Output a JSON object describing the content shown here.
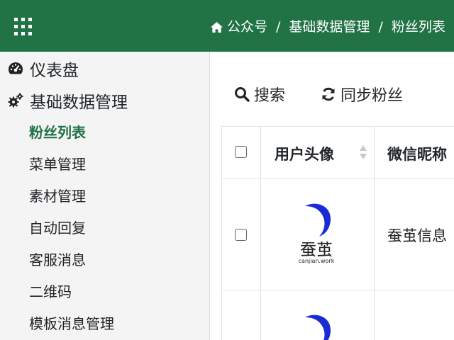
{
  "header": {
    "breadcrumb": [
      "公众号",
      "基础数据管理",
      "粉丝列表"
    ],
    "separator": "/",
    "bg_color": "#217346"
  },
  "sidebar": {
    "top_items": [
      {
        "label": "仪表盘",
        "icon": "dashboard-gauge-icon"
      },
      {
        "label": "基础数据管理",
        "icon": "gears-icon"
      }
    ],
    "sub_items": [
      {
        "label": "粉丝列表",
        "active": true
      },
      {
        "label": "菜单管理"
      },
      {
        "label": "素材管理"
      },
      {
        "label": "自动回复"
      },
      {
        "label": "客服消息"
      },
      {
        "label": "二维码"
      },
      {
        "label": "模板消息管理"
      }
    ]
  },
  "toolbar": {
    "search_label": "搜索",
    "sync_label": "同步粉丝"
  },
  "table": {
    "columns": [
      "用户头像",
      "微信昵称"
    ],
    "rows": [
      {
        "avatar_text": "蚕茧",
        "avatar_sub": "canjian.work",
        "nickname": "蚕茧信息"
      },
      {
        "avatar_text": "",
        "avatar_sub": "",
        "nickname": ""
      }
    ]
  },
  "colors": {
    "accent": "#217346",
    "logo_blue": "#1a2bd6"
  }
}
